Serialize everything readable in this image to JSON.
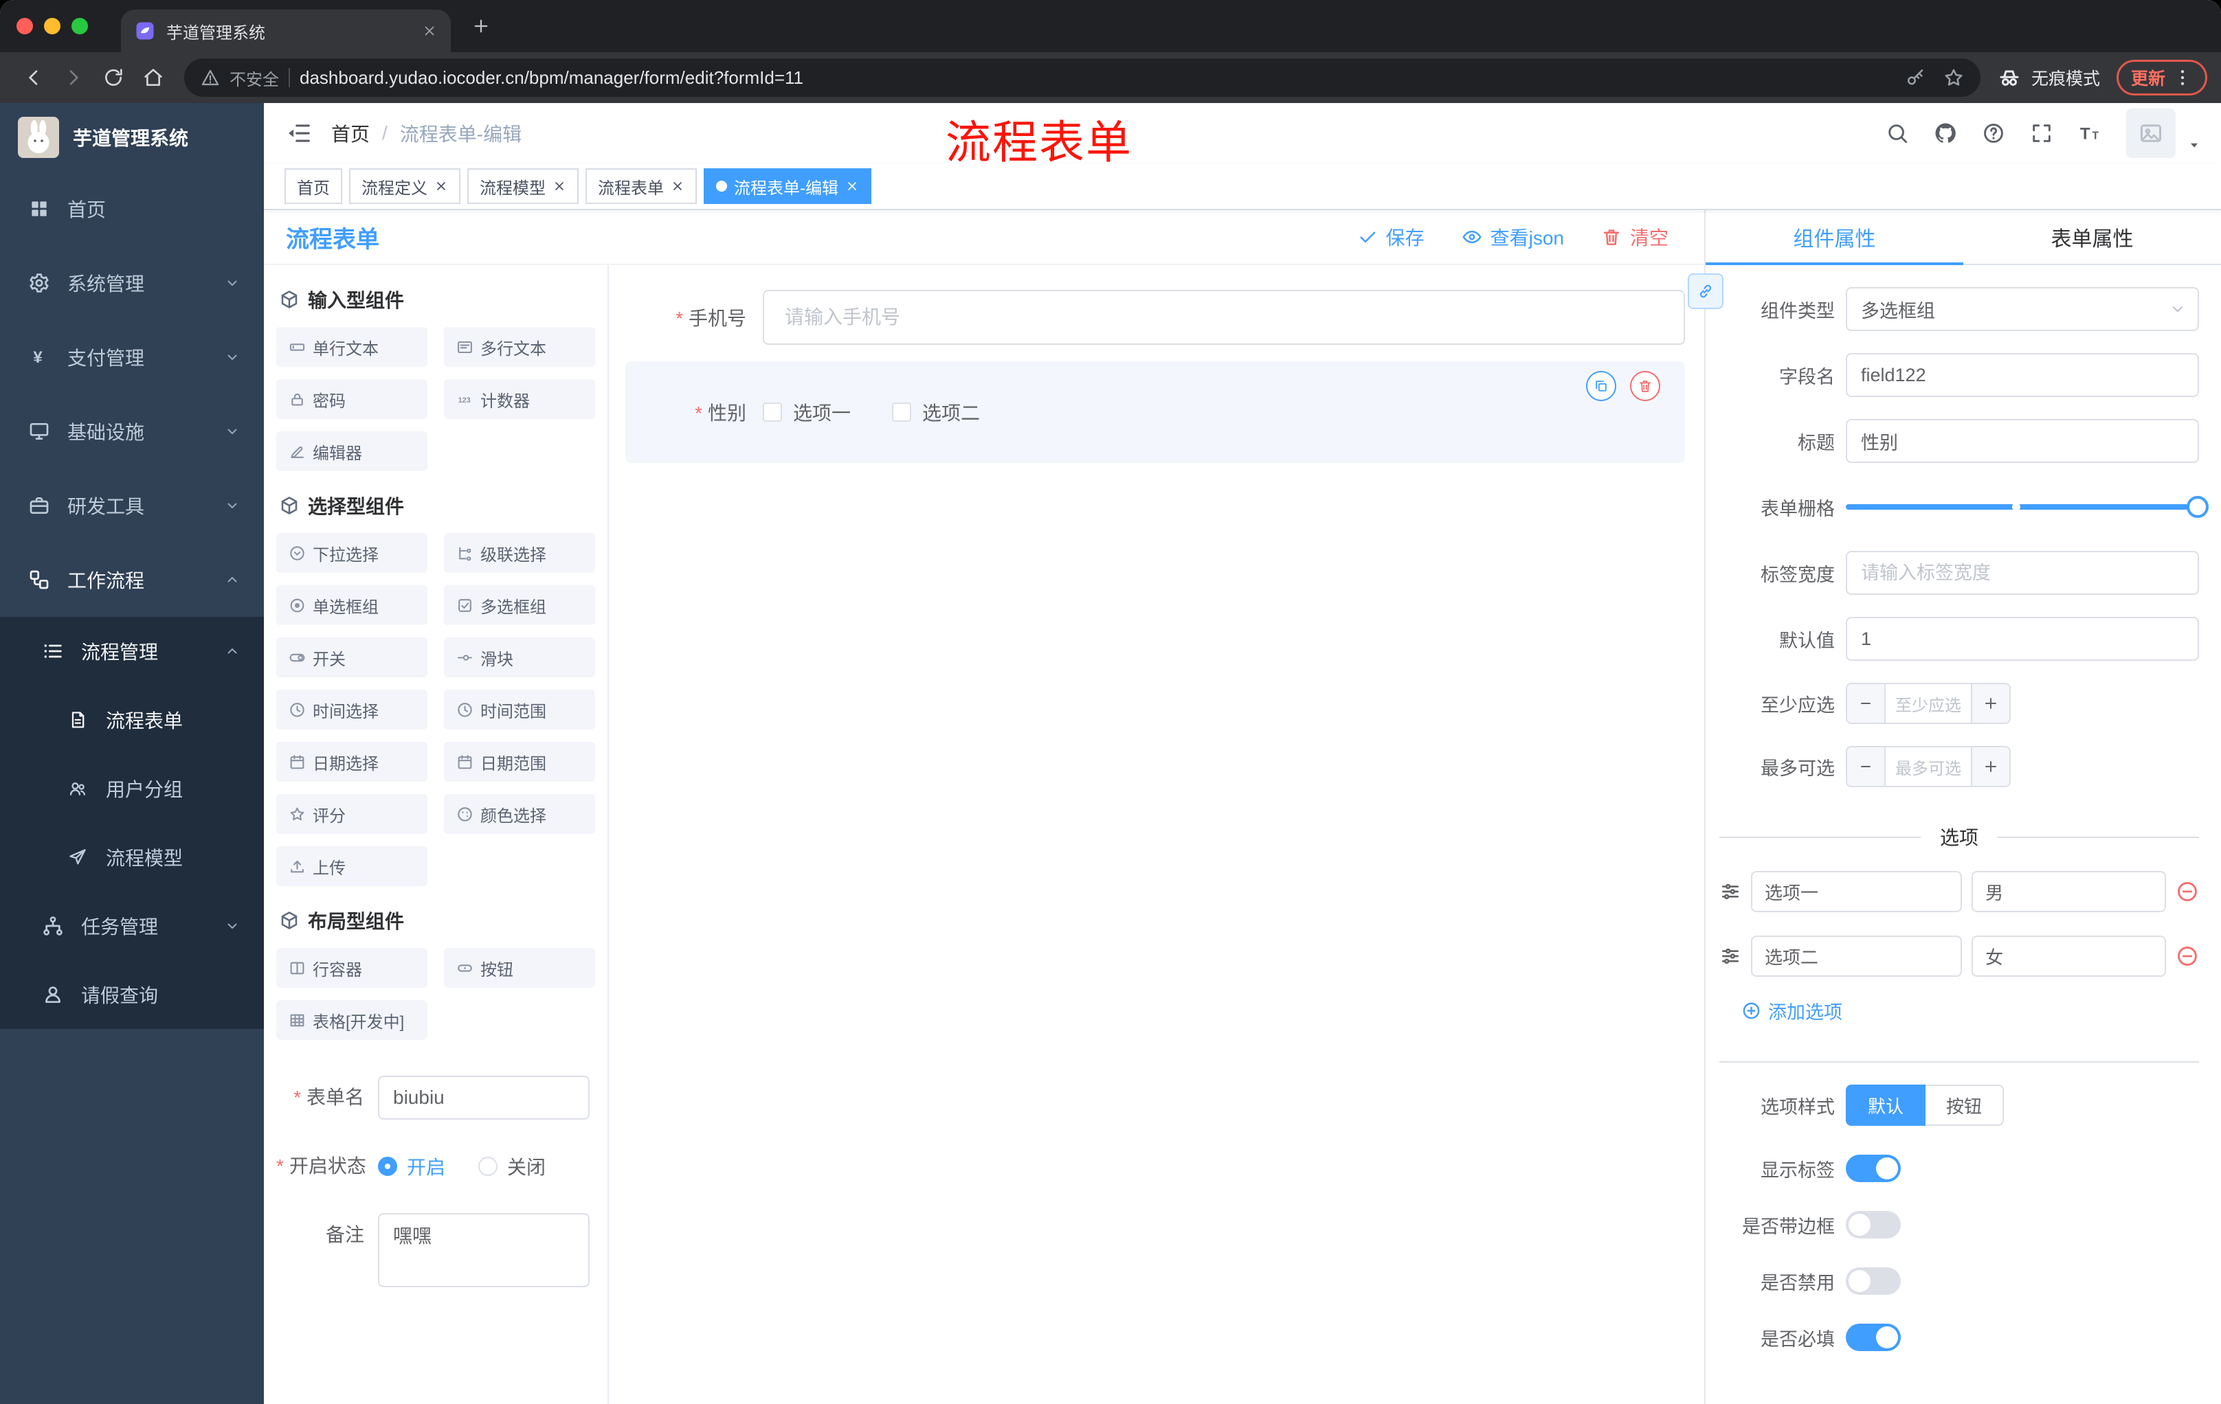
{
  "browser": {
    "tab_title": "芋道管理系统",
    "security_label": "不安全",
    "url": "dashboard.yudao.iocoder.cn/bpm/manager/form/edit?formId=11",
    "incognito_label": "无痕模式",
    "update_label": "更新"
  },
  "sidebar": {
    "logo_title": "芋道管理系统",
    "items": [
      {
        "label": "首页"
      },
      {
        "label": "系统管理"
      },
      {
        "label": "支付管理"
      },
      {
        "label": "基础设施"
      },
      {
        "label": "研发工具"
      },
      {
        "label": "工作流程"
      }
    ],
    "workflow_children": [
      {
        "label": "流程管理"
      },
      {
        "label": "任务管理"
      },
      {
        "label": "请假查询"
      }
    ],
    "process_children": [
      {
        "label": "流程表单"
      },
      {
        "label": "用户分组"
      },
      {
        "label": "流程模型"
      }
    ]
  },
  "header": {
    "breadcrumb_home": "首页",
    "breadcrumb_sep": "/",
    "breadcrumb_current": "流程表单-编辑",
    "annotation": "流程表单"
  },
  "tags": [
    {
      "label": "首页"
    },
    {
      "label": "流程定义"
    },
    {
      "label": "流程模型"
    },
    {
      "label": "流程表单"
    },
    {
      "label": "流程表单-编辑"
    }
  ],
  "designer": {
    "title": "流程表单",
    "save_label": "保存",
    "view_json_label": "查看json",
    "clear_label": "清空",
    "groups": [
      {
        "title": "输入型组件",
        "items": [
          {
            "label": "单行文本"
          },
          {
            "label": "多行文本"
          },
          {
            "label": "密码"
          },
          {
            "label": "计数器"
          },
          {
            "label": "编辑器"
          }
        ]
      },
      {
        "title": "选择型组件",
        "items": [
          {
            "label": "下拉选择"
          },
          {
            "label": "级联选择"
          },
          {
            "label": "单选框组"
          },
          {
            "label": "多选框组"
          },
          {
            "label": "开关"
          },
          {
            "label": "滑块"
          },
          {
            "label": "时间选择"
          },
          {
            "label": "时间范围"
          },
          {
            "label": "日期选择"
          },
          {
            "label": "日期范围"
          },
          {
            "label": "评分"
          },
          {
            "label": "颜色选择"
          },
          {
            "label": "上传"
          }
        ]
      },
      {
        "title": "布局型组件",
        "items": [
          {
            "label": "行容器"
          },
          {
            "label": "按钮"
          },
          {
            "label": "表格[开发中]"
          }
        ]
      }
    ],
    "meta": {
      "form_name_label": "表单名",
      "form_name_value": "biubiu",
      "status_label": "开启状态",
      "status_on": "开启",
      "status_off": "关闭",
      "remark_label": "备注",
      "remark_value": "嘿嘿"
    },
    "canvas": {
      "phone_label": "手机号",
      "phone_placeholder": "请输入手机号",
      "gender_label": "性别",
      "gender_option1": "选项一",
      "gender_option2": "选项二"
    }
  },
  "panel": {
    "tab_component": "组件属性",
    "tab_form": "表单属性",
    "component_type_label": "组件类型",
    "component_type_value": "多选框组",
    "field_name_label": "字段名",
    "field_name_value": "field122",
    "title_label": "标题",
    "title_value": "性别",
    "grid_label": "表单栅格",
    "label_width_label": "标签宽度",
    "label_width_placeholder": "请输入标签宽度",
    "default_label": "默认值",
    "default_value": "1",
    "min_label": "至少应选",
    "min_placeholder": "至少应选",
    "max_label": "最多可选",
    "max_placeholder": "最多可选",
    "options_title": "选项",
    "options": [
      {
        "label": "选项一",
        "value": "男"
      },
      {
        "label": "选项二",
        "value": "女"
      }
    ],
    "add_option_label": "添加选项",
    "style_label": "选项样式",
    "style_default": "默认",
    "style_button": "按钮",
    "toggle_show_label": "显示标签",
    "toggle_border": "是否带边框",
    "toggle_disabled": "是否禁用",
    "toggle_required": "是否必填"
  },
  "colors": {
    "accent": "#409eff",
    "danger": "#f56c6c",
    "sidebar_bg": "#304156",
    "sidebar_sub_bg": "#1f2d3d",
    "annotation": "#fb1508"
  }
}
